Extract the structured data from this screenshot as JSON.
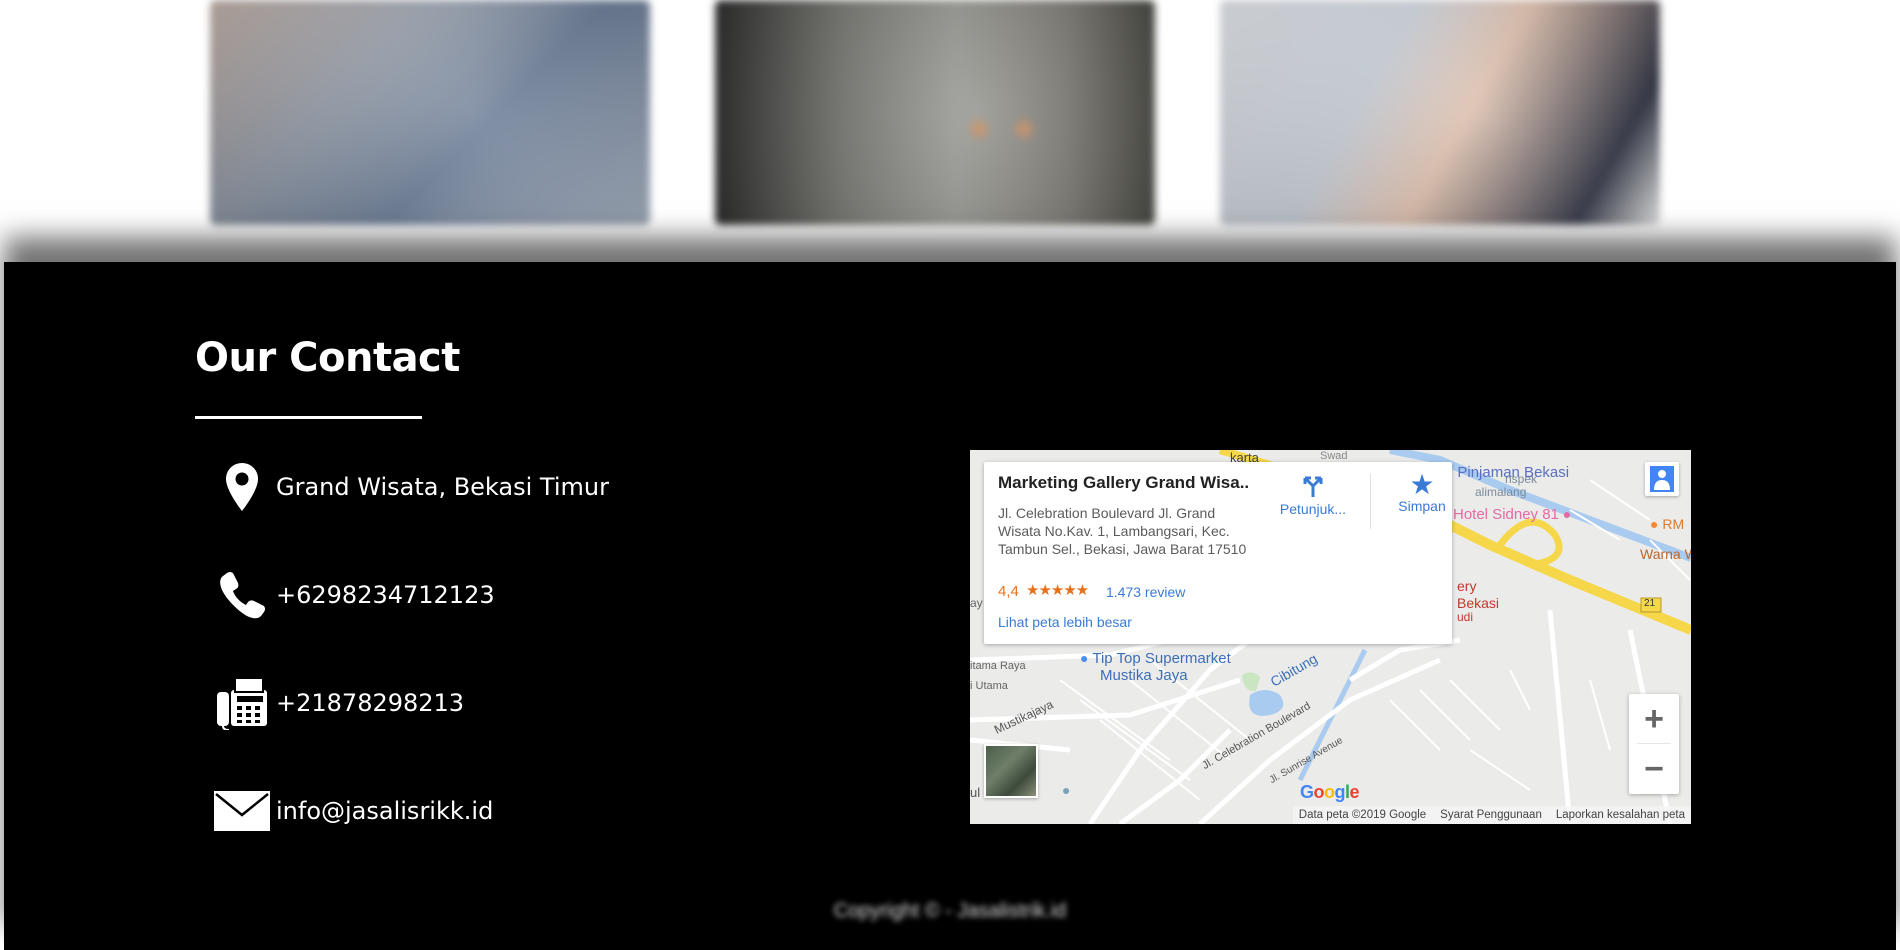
{
  "contact": {
    "title": "Our Contact",
    "items": [
      {
        "icon": "map-pin-icon",
        "text": "Grand Wisata, Bekasi Timur"
      },
      {
        "icon": "phone-icon",
        "text": "+6298234712123"
      },
      {
        "icon": "fax-icon",
        "text": "+21878298213"
      },
      {
        "icon": "envelope-icon",
        "text": "info@jasalisrikk.id"
      }
    ]
  },
  "map": {
    "card": {
      "title": "Marketing Gallery Grand Wisa...",
      "address": "Jl. Celebration Boulevard Jl. Grand Wisata No.Kav. 1, Lambangsari, Kec. Tambun Sel., Bekasi, Jawa Barat 17510",
      "rating": "4,4",
      "stars": "★★★★★",
      "reviews": "1.473 review",
      "larger_map": "Lihat peta lebih besar",
      "directions": "Petunjuk...",
      "save": "Simpan"
    },
    "labels": {
      "pinjaman": "Pinjaman Bekasi",
      "hotel": "Hotel Sidney 81",
      "rm": "RM",
      "warna": "Warna W",
      "supermarket_1": "Tip Top Supermarket",
      "supermarket_2": "Mustika Jaya",
      "cibitung": "Cibitung",
      "mustikajaya": "Mustikajaya",
      "boulevard": "Jl. Celebration Boulevard",
      "sunrise": "Jl. Sunrise Avenue",
      "karta": "karta",
      "ery": "ery",
      "bekasi": "Bekasi",
      "udi": "udi",
      "route": "21",
      "tama_raya": "itama Raya",
      "utama": "i Utama",
      "selatan": "ul Selatan",
      "ay": "ay",
      "jalimalang": "alimalang",
      "inspek": "nspek",
      "swad": "Swad"
    },
    "google": "Google",
    "attribution": {
      "data": "Data peta ©2019 Google",
      "terms": "Syarat Penggunaan",
      "report": "Laporkan kesalahan peta"
    },
    "zoom_in": "+",
    "zoom_out": "−"
  },
  "footer": {
    "copyright": "Copyright © - Jasalistrik.id"
  },
  "colors": {
    "footer_bg": "#000000",
    "link_blue": "#3a7bd5",
    "rating_orange": "#e7711b",
    "highway_yellow": "#f6d74a"
  }
}
